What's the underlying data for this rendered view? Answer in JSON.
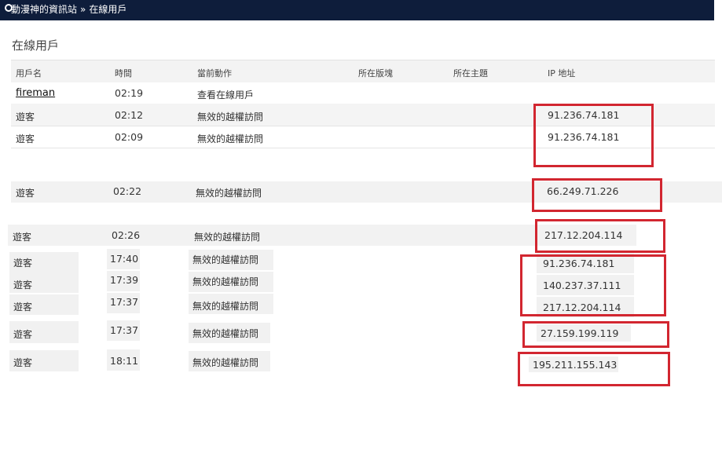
{
  "breadcrumb": {
    "site": "動漫神的資訊站",
    "separator": "»",
    "current": "在線用戶"
  },
  "page_title": "在線用戶",
  "table": {
    "headers": {
      "user": "用戶名",
      "time": "時間",
      "action": "當前動作",
      "forum": "所在版塊",
      "topic": "所在主題",
      "ip": "IP 地址"
    },
    "rows": [
      {
        "user": "fireman",
        "time": "02:19",
        "action": "查看在線用戶",
        "ip": ""
      },
      {
        "user": "遊客",
        "time": "02:12",
        "action": "無效的越權訪問",
        "ip": "91.236.74.181"
      },
      {
        "user": "遊客",
        "time": "02:09",
        "action": "無效的越權訪問",
        "ip": "91.236.74.181"
      },
      {
        "user": "遊客",
        "time": "02:22",
        "action": "無效的越權訪問",
        "ip": "66.249.71.226"
      },
      {
        "user": "遊客",
        "time": "02:26",
        "action": "無效的越權訪問",
        "ip": "217.12.204.114"
      },
      {
        "user": "遊客",
        "time": "17:40",
        "action": "無效的越權訪問",
        "ip": "91.236.74.181"
      },
      {
        "user": "遊客",
        "time": "17:39",
        "action": "無效的越權訪問",
        "ip": "140.237.37.111"
      },
      {
        "user": "遊客",
        "time": "17:37",
        "action": "無效的越權訪問",
        "ip": "217.12.204.114"
      },
      {
        "user": "遊客",
        "time": "17:37",
        "action": "無效的越權訪問",
        "ip": "27.159.199.119"
      },
      {
        "user": "遊客",
        "time": "18:11",
        "action": "無效的越權訪問",
        "ip": "195.211.155.143"
      }
    ]
  },
  "colors": {
    "topbar": "#0e1d3b",
    "highlight_box": "#d22630",
    "row_shade": "#f4f4f4"
  },
  "icons": {
    "breadcrumb": "home-icon"
  }
}
